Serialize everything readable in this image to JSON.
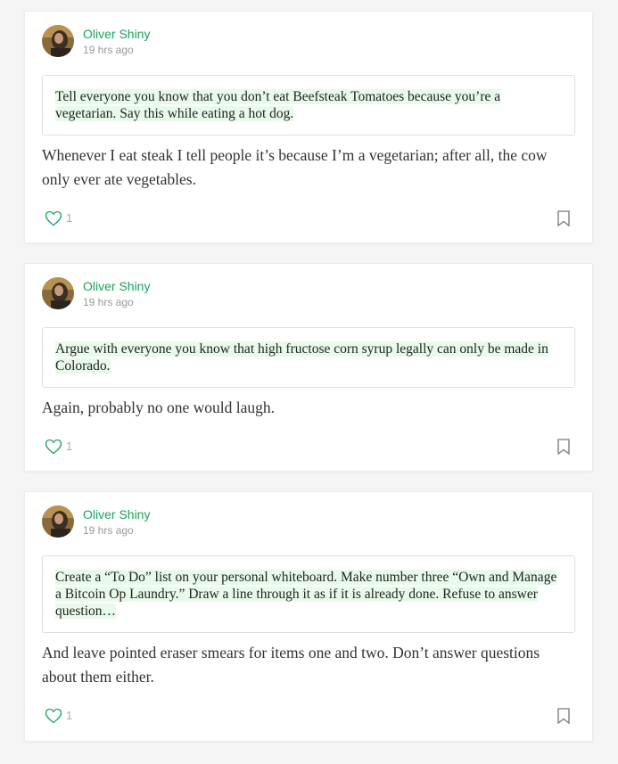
{
  "colors": {
    "accent": "#1aa35b",
    "highlight": "#e8fbea",
    "background": "#f5f5f5"
  },
  "posts": [
    {
      "author": "Oliver Shiny",
      "time": "19 hrs ago",
      "quote": "Tell everyone you know that you don’t eat Beefsteak Tomatoes because you’re a vegetarian. Say this while eating a hot dog.",
      "body": "Whenever I eat steak I tell people it’s because I’m a vegetarian; after all, the cow only ever ate vegetables.",
      "likes": "1",
      "like_icon": "heart-outline-icon",
      "bookmark_icon": "bookmark-icon"
    },
    {
      "author": "Oliver Shiny",
      "time": "19 hrs ago",
      "quote": "Argue with everyone you know that high fructose corn syrup legally can only be made in Colorado.",
      "body": "Again, probably no one would laugh.",
      "likes": "1",
      "like_icon": "heart-outline-icon",
      "bookmark_icon": "bookmark-icon"
    },
    {
      "author": "Oliver Shiny",
      "time": "19 hrs ago",
      "quote": "Create a “To Do” list on your personal whiteboard. Make number three “Own and Manage a Bitcoin Op Laundry.” Draw a line through it as if it is already done. Refuse to answer question…",
      "body": "And leave pointed eraser smears for items one and two. Don’t answer questions about them either.",
      "likes": "1",
      "like_icon": "heart-outline-icon",
      "bookmark_icon": "bookmark-icon"
    }
  ]
}
